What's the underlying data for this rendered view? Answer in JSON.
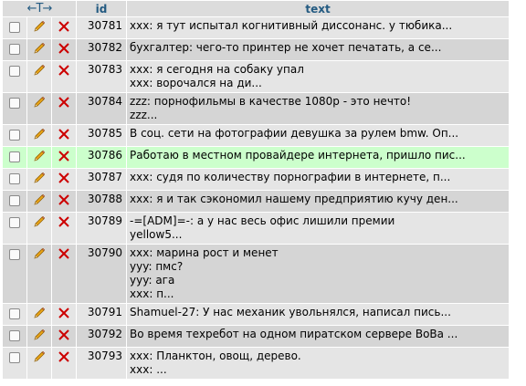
{
  "header": {
    "arrows": "←T→",
    "id_label": "id",
    "text_label": "text"
  },
  "rows": [
    {
      "id": "30781",
      "text": "xxx: я тут испытал когнитивный диссонанс. у тюбика..."
    },
    {
      "id": "30782",
      "text": "бухгалтер: чего-то принтер не хочет печатать, а се..."
    },
    {
      "id": "30783",
      "text": "xxx: я сегодня на собаку упал\nxxx: ворочался на ди..."
    },
    {
      "id": "30784",
      "text": "zzz: порнофильмы в качестве 1080p - это нечто!\nzzz..."
    },
    {
      "id": "30785",
      "text": "В соц. сети на фотографии девушка за рулем bmw. Оп..."
    },
    {
      "id": "30786",
      "text": "Работаю в местном провайдере интернета, пришло пис..."
    },
    {
      "id": "30787",
      "text": "xxx: судя по количеству порнографии в интернете, п..."
    },
    {
      "id": "30788",
      "text": "xxx: я и так сэкономил нашему предприятию кучу ден..."
    },
    {
      "id": "30789",
      "text": "-=[ADM]=-: а у нас весь офис лишили премии\nyellow5..."
    },
    {
      "id": "30790",
      "text": "xxx: марина рост и менет\nyyy: пмс?\nyyy: ага\nxxx: п..."
    },
    {
      "id": "30791",
      "text": "Shamuel-27: У нас механик увольнялся, написал пись..."
    },
    {
      "id": "30792",
      "text": "Во время техребот на одном пиратском сервере ВоВа ..."
    },
    {
      "id": "30793",
      "text": "xxx: Планктон, овощ, дерево.\nxxx: ..."
    }
  ],
  "colors": {
    "edit_icon": "#e8a317",
    "delete_icon": "#cc0000",
    "header_text": "#235a81",
    "hover_row": "#ccffcc"
  }
}
